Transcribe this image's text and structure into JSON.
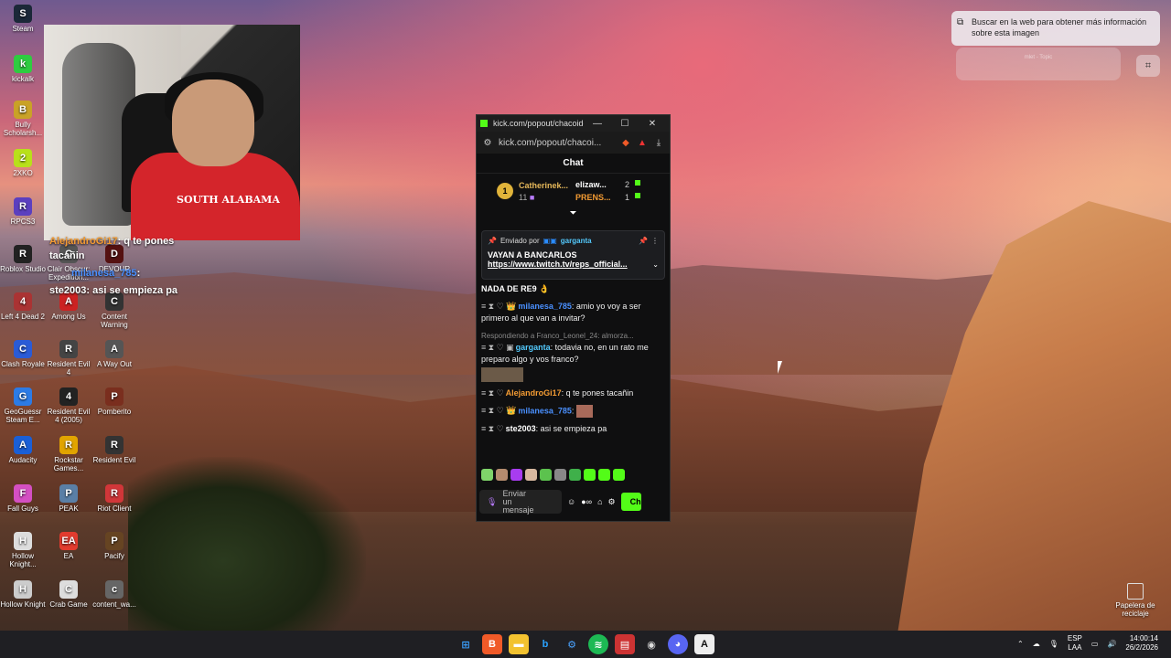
{
  "desktop": {
    "icons": [
      {
        "label": "Steam",
        "glyph": "S",
        "color": "#1b2838"
      },
      {
        "label": "kickalk",
        "glyph": "k",
        "color": "#2ecc40"
      },
      {
        "label": "Bully Scholarsh...",
        "glyph": "B",
        "color": "#c9a227"
      },
      {
        "label": "2XKO",
        "glyph": "2",
        "color": "#b8e01a"
      },
      {
        "label": "RPCS3",
        "glyph": "R",
        "color": "#5b3fbf"
      },
      {
        "label": "Roblox Studio",
        "glyph": "R",
        "color": "#222"
      },
      {
        "label": "Left 4 Dead 2",
        "glyph": "4",
        "color": "#a33"
      },
      {
        "label": "Among Us",
        "glyph": "A",
        "color": "#c22"
      },
      {
        "label": "Content Warning",
        "glyph": "C",
        "color": "#333"
      },
      {
        "label": "Clash Royale",
        "glyph": "C",
        "color": "#2a5bd6"
      },
      {
        "label": "Resident Evil 4",
        "glyph": "R",
        "color": "#444"
      },
      {
        "label": "A Way Out",
        "glyph": "A",
        "color": "#555"
      },
      {
        "label": "GeoGuessr Steam E...",
        "glyph": "G",
        "color": "#2c7be5"
      },
      {
        "label": "Resident Evil 4 (2005)",
        "glyph": "4",
        "color": "#222"
      },
      {
        "label": "Pomberito",
        "glyph": "P",
        "color": "#7a2e1e"
      },
      {
        "label": "Audacity",
        "glyph": "A",
        "color": "#1a5fd6"
      },
      {
        "label": "Rockstar Games...",
        "glyph": "R",
        "color": "#e1a400"
      },
      {
        "label": "Resident Evil",
        "glyph": "R",
        "color": "#333"
      },
      {
        "label": "Fall Guys",
        "glyph": "F",
        "color": "#d44fc2"
      },
      {
        "label": "PEAK",
        "glyph": "P",
        "color": "#5a7fa6"
      },
      {
        "label": "Riot Client",
        "glyph": "R",
        "color": "#d13639"
      },
      {
        "label": "Hollow Knight...",
        "glyph": "H",
        "color": "#ddd"
      },
      {
        "label": "EA",
        "glyph": "EA",
        "color": "#e23b2e"
      },
      {
        "label": "Pacify",
        "glyph": "P",
        "color": "#642"
      },
      {
        "label": "Hollow Knight",
        "glyph": "H",
        "color": "#ccc"
      },
      {
        "label": "Crab Game",
        "glyph": "C",
        "color": "#ddd"
      },
      {
        "label": "content_wa...",
        "glyph": "c",
        "color": "#666"
      },
      {
        "label": "Clair Obscur: Expedition...",
        "glyph": "C",
        "color": "#555"
      },
      {
        "label": "DEVOUR",
        "glyph": "D",
        "color": "#511"
      }
    ],
    "recycle_bin": "Papelera de reciclaje"
  },
  "webcam": {
    "shirt_text": "SOUTH ALABAMA"
  },
  "overlay_chat": [
    {
      "user": "AlejandroGi17",
      "text": ": q te pones"
    },
    {
      "user": "",
      "text": "tacañin"
    },
    {
      "user": "milanesa_785",
      "text": ":"
    },
    {
      "user": "ste2003",
      "text": ": asi se empieza pa"
    }
  ],
  "popup": {
    "title": "kick.com/popout/chacoide/...",
    "url": "kick.com/popout/chacoi...",
    "chat_header": "Chat",
    "leaderboard": {
      "rank": "1",
      "first_name": "Catherinek...",
      "first_count": "11",
      "second_name": "elizaw...",
      "second_count": "2",
      "third_name": "PRENS...",
      "third_count": "1"
    },
    "pinned": {
      "sent_by_label": "Enviado por",
      "sender": "garganta",
      "message": "VAYAN A BANCARLOS",
      "link": "https://www.twitch.tv/reps_official..."
    },
    "messages": [
      {
        "user": "",
        "text": "NADA DE RE9",
        "reply": "",
        "user_class": "user-white"
      },
      {
        "user": "milanesa_785",
        "text": ": amio yo voy a ser primero al que van a invitar?",
        "reply": "",
        "user_class": "user-blue"
      },
      {
        "user": "garganta",
        "text": ": todavia no, en un rato me preparo algo y vos franco?",
        "reply": "Respondiendo a Franco_Leonel_24: almorza...",
        "user_class": "user-cyan"
      },
      {
        "user": "AlejandroGi17",
        "text": ": q te pones tacañin",
        "reply": "",
        "user_class": "user-orange"
      },
      {
        "user": "milanesa_785",
        "text": ":",
        "reply": "",
        "user_class": "user-blue"
      },
      {
        "user": "ste2003",
        "text": ": asi se empieza pa",
        "reply": "",
        "user_class": "user-white"
      }
    ],
    "input_placeholder": "Enviar un mensaje",
    "chat_button": "Ch"
  },
  "lens_tooltip": "Buscar en la web para obtener más información sobre esta imagen",
  "media_blur": "mlet - Topic",
  "taskbar": {
    "apps": [
      "windows-start",
      "brave",
      "explorer",
      "bing",
      "steam",
      "spotify",
      "news",
      "obs",
      "discord",
      "epic"
    ],
    "lang_top": "ESP",
    "lang_bottom": "LAA",
    "time": "14:00:14",
    "date": "26/2/2026"
  },
  "colors": {
    "kick_green": "#53fc18",
    "gold": "#e0b33a"
  }
}
